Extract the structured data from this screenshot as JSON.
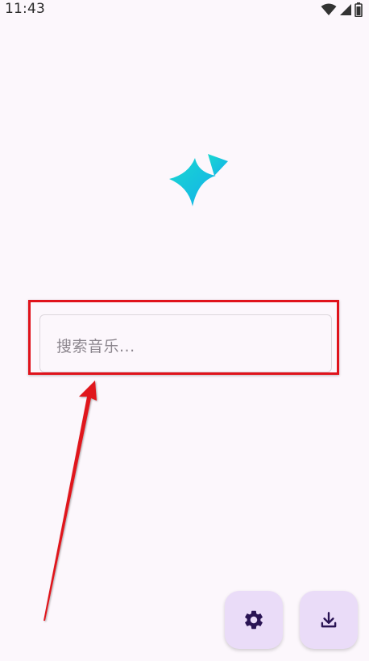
{
  "status_bar": {
    "time": "11:43",
    "icons": [
      "wifi-icon",
      "cell-signal-icon",
      "battery-icon"
    ]
  },
  "logo": {
    "icon": "sparkle-icon",
    "colors": [
      "#1ad0d8",
      "#12b8e8"
    ]
  },
  "search": {
    "placeholder": "搜索音乐..."
  },
  "annotation": {
    "box_color": "#e0131c",
    "arrow_color": "#e0131c"
  },
  "fabs": [
    {
      "name": "settings",
      "icon": "gear-icon"
    },
    {
      "name": "download",
      "icon": "download-icon"
    }
  ],
  "colors": {
    "background": "#fcf7fc",
    "fab": "#eadcf8",
    "fab_icon": "#2a1454"
  }
}
